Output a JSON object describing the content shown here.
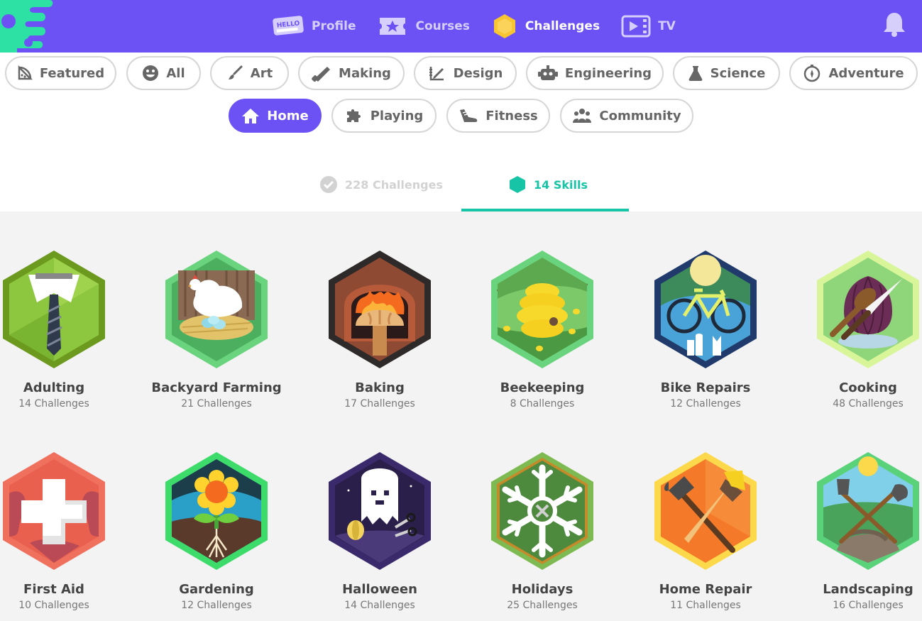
{
  "nav": {
    "items": [
      {
        "label": "Profile",
        "icon": "hello-badge-icon"
      },
      {
        "label": "Courses",
        "icon": "star-ticket-icon"
      },
      {
        "label": "Challenges",
        "icon": "hexagon-icon",
        "active": true
      },
      {
        "label": "TV",
        "icon": "tv-play-icon"
      }
    ],
    "hello_text": "HELLO"
  },
  "categories": [
    {
      "label": "Featured",
      "icon": "pizza-icon"
    },
    {
      "label": "All",
      "icon": "smiley-icon"
    },
    {
      "label": "Art",
      "icon": "brush-icon"
    },
    {
      "label": "Making",
      "icon": "saw-icon"
    },
    {
      "label": "Design",
      "icon": "pencil-ruler-icon"
    },
    {
      "label": "Engineering",
      "icon": "robot-icon"
    },
    {
      "label": "Science",
      "icon": "flask-icon"
    },
    {
      "label": "Adventure",
      "icon": "compass-icon"
    },
    {
      "label": "Home",
      "icon": "house-icon",
      "active": true
    },
    {
      "label": "Playing",
      "icon": "puzzle-icon"
    },
    {
      "label": "Fitness",
      "icon": "shoe-icon"
    },
    {
      "label": "Community",
      "icon": "people-icon"
    }
  ],
  "tabs": {
    "challenges": "228 Challenges",
    "skills": "14 Skills"
  },
  "skills": [
    {
      "name": "Adulting",
      "count": "14 Challenges",
      "icon": "necktie-badge-icon"
    },
    {
      "name": "Backyard Farming",
      "count": "21 Challenges",
      "icon": "chicken-nest-badge-icon"
    },
    {
      "name": "Baking",
      "count": "17 Challenges",
      "icon": "bread-oven-badge-icon"
    },
    {
      "name": "Beekeeping",
      "count": "8 Challenges",
      "icon": "beehive-badge-icon"
    },
    {
      "name": "Bike Repairs",
      "count": "12 Challenges",
      "icon": "bicycle-tools-badge-icon"
    },
    {
      "name": "Cooking",
      "count": "48 Challenges",
      "icon": "onion-knife-badge-icon"
    },
    {
      "name": "First Aid",
      "count": "10 Challenges",
      "icon": "medical-cross-badge-icon"
    },
    {
      "name": "Gardening",
      "count": "12 Challenges",
      "icon": "flower-badge-icon"
    },
    {
      "name": "Halloween",
      "count": "14 Challenges",
      "icon": "ghost-badge-icon"
    },
    {
      "name": "Holidays",
      "count": "25 Challenges",
      "icon": "snowflake-badge-icon"
    },
    {
      "name": "Home Repair",
      "count": "11 Challenges",
      "icon": "hammer-brush-badge-icon"
    },
    {
      "name": "Landscaping",
      "count": "16 Challenges",
      "icon": "shovels-badge-icon"
    }
  ],
  "colors": {
    "header": "#6c52f5",
    "accent": "#17c4a5",
    "logo_slime": "#2de0a3"
  }
}
